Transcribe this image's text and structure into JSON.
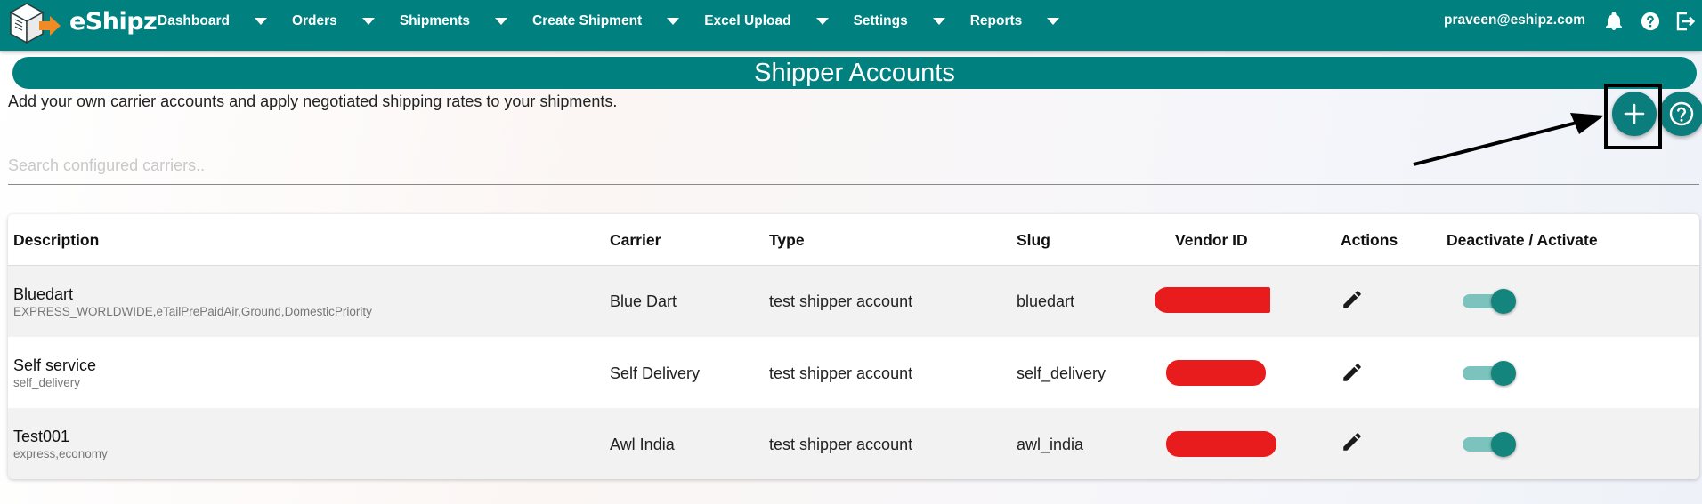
{
  "brand": {
    "name": "eShipz"
  },
  "nav": {
    "items": [
      {
        "label": "Dashboard"
      },
      {
        "label": "Orders"
      },
      {
        "label": "Shipments"
      },
      {
        "label": "Create Shipment"
      },
      {
        "label": "Excel Upload"
      },
      {
        "label": "Settings"
      },
      {
        "label": "Reports"
      }
    ],
    "user_email": "praveen@eshipz.com",
    "icons": [
      "bell-icon",
      "help-icon",
      "logout-icon"
    ]
  },
  "page": {
    "title": "Shipper Accounts",
    "subtitle": "Add your own carrier accounts and apply negotiated shipping rates to your shipments.",
    "add_icon": "plus-icon",
    "help_icon": "question-circle-icon"
  },
  "search": {
    "placeholder": "Search configured carriers..",
    "value": ""
  },
  "table": {
    "headers": {
      "description": "Description",
      "carrier": "Carrier",
      "type": "Type",
      "slug": "Slug",
      "vendor_id": "Vendor ID",
      "actions": "Actions",
      "toggle": "Deactivate / Activate"
    },
    "rows": [
      {
        "name": "Bluedart",
        "services": "EXPRESS_WORLDWIDE,eTailPrePaidAir,Ground,DomesticPriority",
        "carrier": "Blue Dart",
        "type": "test shipper account",
        "slug": "bluedart",
        "vendor_id_redacted": true,
        "active": true
      },
      {
        "name": "Self service",
        "services": "self_delivery",
        "carrier": "Self Delivery",
        "type": "test shipper account",
        "slug": "self_delivery",
        "vendor_id_redacted": true,
        "active": true
      },
      {
        "name": "Test001",
        "services": "express,economy",
        "carrier": "Awl India",
        "type": "test shipper account",
        "slug": "awl_india",
        "vendor_id_redacted": true,
        "active": true
      }
    ]
  },
  "colors": {
    "brand_teal": "#00807f",
    "toggle_on": "#13857c",
    "redaction": "#e81c1c"
  }
}
